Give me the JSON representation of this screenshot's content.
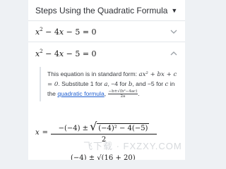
{
  "panel": {
    "title": "Steps Using the Quadratic Formula",
    "title_caret": "▼"
  },
  "steps": [
    {
      "equation": "x² − 4x − 5 = 0",
      "chevron": "chevron-down-icon"
    },
    {
      "equation": "x² − 4x − 5 = 0",
      "chevron": "chevron-up-icon"
    }
  ],
  "explanation": {
    "part1": "This equation is in standard form: ",
    "standard_form": "ax² + bx + c = 0",
    "part2": ". Substitute 1 for ",
    "var_a": "a",
    "part3": ", −4 for ",
    "var_b": "b",
    "part4": ", and −5 for ",
    "var_c": "c",
    "part5": " in the ",
    "link_text": "quadratic formula",
    "part6": ", ",
    "mini_formula_num": "−b±√(b²−4ac)",
    "mini_formula_den": "2a",
    "part7": "."
  },
  "formula": {
    "lhs": "x",
    "equals": "=",
    "numerator_prefix": "−(−4) ±",
    "radical": "√",
    "radicand": "(−4)² − 4(−5)",
    "denominator": "2"
  },
  "next_line": "(−4) ± √(16 + 20)",
  "watermark": "飞下载 · FXZXY.COM",
  "colors": {
    "link": "#1f5fd1",
    "divider": "#e3e6ea",
    "background": "#eef1f4"
  }
}
